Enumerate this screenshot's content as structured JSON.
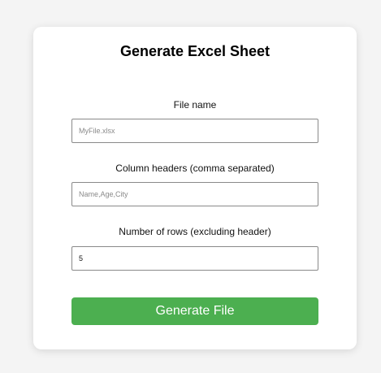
{
  "form": {
    "title": "Generate Excel Sheet",
    "file_name": {
      "label": "File name",
      "placeholder": "MyFile.xlsx",
      "value": ""
    },
    "column_headers": {
      "label": "Column headers (comma separated)",
      "placeholder": "Name,Age,City",
      "value": ""
    },
    "row_count": {
      "label": "Number of rows (excluding header)",
      "value": "5"
    },
    "submit_label": "Generate File"
  },
  "colors": {
    "page_background": "#f4f4f4",
    "card_background": "#ffffff",
    "button_background": "#4caf50",
    "button_text": "#ffffff",
    "field_border": "#8a8a8a"
  }
}
